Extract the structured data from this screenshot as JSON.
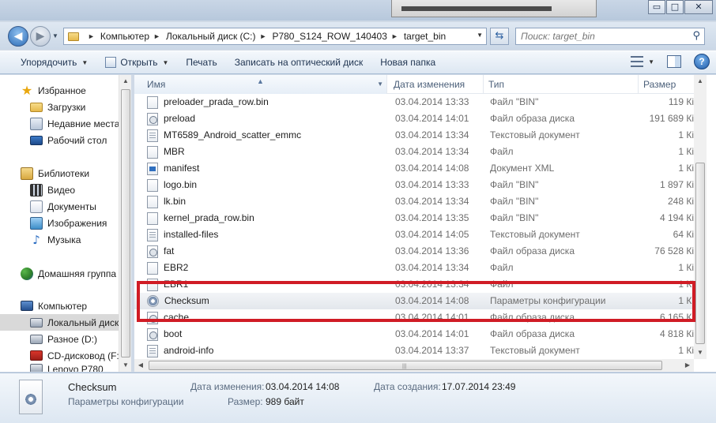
{
  "window": {
    "controls": {
      "minimize": "▭",
      "maximize": "□",
      "close": "✕"
    }
  },
  "address": {
    "breadcrumbs": [
      "Компьютер",
      "Локальный диск (C:)",
      "P780_S124_ROW_140403",
      "target_bin"
    ],
    "search_placeholder": "Поиск: target_bin"
  },
  "toolbar": {
    "organize": "Упорядочить",
    "open": "Открыть",
    "print": "Печать",
    "burn": "Записать на оптический диск",
    "new_folder": "Новая папка",
    "help": "?"
  },
  "nav": {
    "favorites": "Избранное",
    "downloads": "Загрузки",
    "recent": "Недавние места",
    "desktop": "Рабочий стол",
    "libraries": "Библиотеки",
    "video": "Видео",
    "documents": "Документы",
    "pictures": "Изображения",
    "music": "Музыка",
    "homegroup": "Домашняя группа",
    "computer": "Компьютер",
    "local_disk": "Локальный диск",
    "drive_d": "Разное (D:)",
    "cd_drive": "CD-дисковод (F:",
    "lenovo": "Lenovo P780"
  },
  "columns": {
    "name": "Имя",
    "date": "Дата изменения",
    "type": "Тип",
    "size": "Размер"
  },
  "files": [
    {
      "name": "preloader_prada_row.bin",
      "date": "03.04.2014 13:33",
      "type": "Файл \"BIN\"",
      "size": "119 Кі",
      "icon": "file-icon"
    },
    {
      "name": "preload",
      "date": "03.04.2014 14:01",
      "type": "Файл образа диска",
      "size": "191 689 Кі",
      "icon": "disk-image-icon"
    },
    {
      "name": "MT6589_Android_scatter_emmc",
      "date": "03.04.2014 13:34",
      "type": "Текстовый документ",
      "size": "1 Кі",
      "icon": "text-file-icon"
    },
    {
      "name": "MBR",
      "date": "03.04.2014 13:34",
      "type": "Файл",
      "size": "1 Кі",
      "icon": "file-icon"
    },
    {
      "name": "manifest",
      "date": "03.04.2014 14:08",
      "type": "Документ XML",
      "size": "1 Кі",
      "icon": "xml-file-icon"
    },
    {
      "name": "logo.bin",
      "date": "03.04.2014 13:33",
      "type": "Файл \"BIN\"",
      "size": "1 897 Кі",
      "icon": "file-icon"
    },
    {
      "name": "lk.bin",
      "date": "03.04.2014 13:34",
      "type": "Файл \"BIN\"",
      "size": "248 Кі",
      "icon": "file-icon"
    },
    {
      "name": "kernel_prada_row.bin",
      "date": "03.04.2014 13:35",
      "type": "Файл \"BIN\"",
      "size": "4 194 Кі",
      "icon": "file-icon"
    },
    {
      "name": "installed-files",
      "date": "03.04.2014 14:05",
      "type": "Текстовый документ",
      "size": "64 Кі",
      "icon": "text-file-icon"
    },
    {
      "name": "fat",
      "date": "03.04.2014 13:36",
      "type": "Файл образа диска",
      "size": "76 528 Кі",
      "icon": "disk-image-icon"
    },
    {
      "name": "EBR2",
      "date": "03.04.2014 13:34",
      "type": "Файл",
      "size": "1 Кі",
      "icon": "file-icon"
    },
    {
      "name": "EBR1",
      "date": "03.04.2014 13:34",
      "type": "Файл",
      "size": "1 Кі",
      "icon": "file-icon"
    },
    {
      "name": "Checksum",
      "date": "03.04.2014 14:08",
      "type": "Параметры конфигурации",
      "size": "1 Кі",
      "icon": "config-file-icon"
    },
    {
      "name": "cache",
      "date": "03.04.2014 14:01",
      "type": "Файл образа диска",
      "size": "6 165 Кі",
      "icon": "disk-image-icon"
    },
    {
      "name": "boot",
      "date": "03.04.2014 14:01",
      "type": "Файл образа диска",
      "size": "4 818 Кі",
      "icon": "disk-image-icon"
    },
    {
      "name": "android-info",
      "date": "03.04.2014 13:37",
      "type": "Текстовый документ",
      "size": "1 Кі",
      "icon": "text-file-icon"
    }
  ],
  "selected_index": 12,
  "details": {
    "name": "Checksum",
    "type": "Параметры конфигурации",
    "modified_label": "Дата изменения:",
    "modified_value": "03.04.2014 14:08",
    "created_label": "Дата создания:",
    "created_value": "17.07.2014 23:49",
    "size_label": "Размер:",
    "size_value": "989 байт"
  },
  "colors": {
    "highlight_box": "#d01c25",
    "selected_row": "#e6e9ee"
  }
}
